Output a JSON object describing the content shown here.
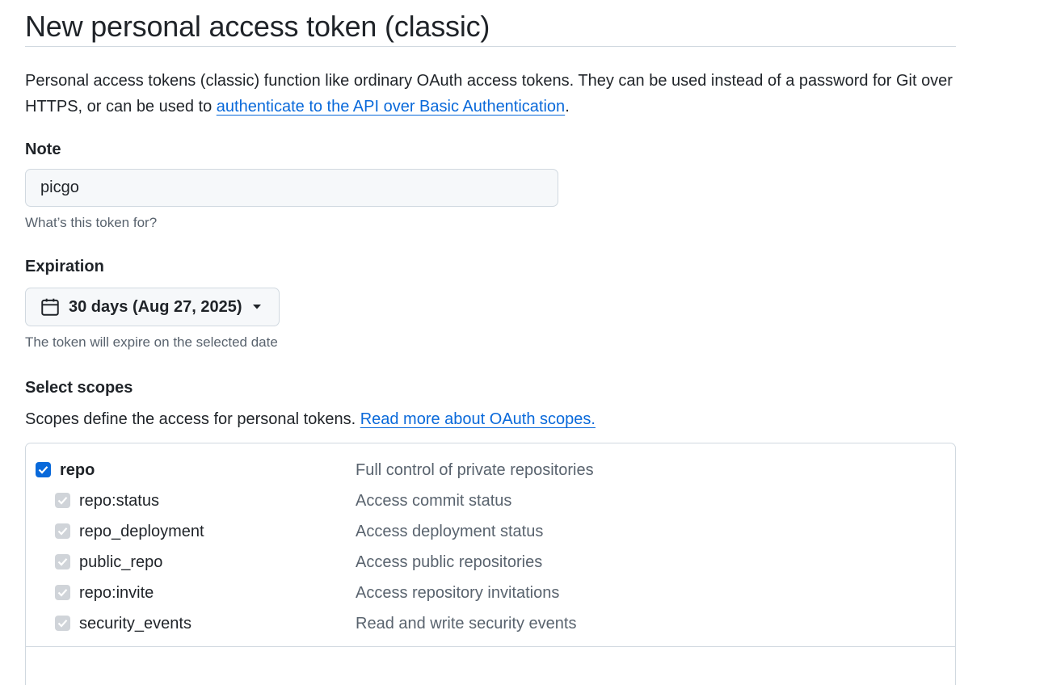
{
  "page": {
    "title": "New personal access token (classic)"
  },
  "intro": {
    "text_before": "Personal access tokens (classic) function like ordinary OAuth access tokens. They can be used instead of a password for Git over HTTPS, or can be used to ",
    "link_text": "authenticate to the API over Basic Authentication",
    "text_after": "."
  },
  "note": {
    "label": "Note",
    "value": "picgo",
    "hint": "What’s this token for?"
  },
  "expiration": {
    "label": "Expiration",
    "selected": "30 days (Aug 27, 2025)",
    "icon": "calendar-icon",
    "hint": "The token will expire on the selected date"
  },
  "scopes": {
    "label": "Select scopes",
    "description": "Scopes define the access for personal tokens. ",
    "link_text": "Read more about OAuth scopes.",
    "items": [
      {
        "name": "repo",
        "description": "Full control of private repositories",
        "checked": true,
        "disabled": false,
        "parent": true
      },
      {
        "name": "repo:status",
        "description": "Access commit status",
        "checked": true,
        "disabled": true,
        "parent": false
      },
      {
        "name": "repo_deployment",
        "description": "Access deployment status",
        "checked": true,
        "disabled": true,
        "parent": false
      },
      {
        "name": "public_repo",
        "description": "Access public repositories",
        "checked": true,
        "disabled": true,
        "parent": false
      },
      {
        "name": "repo:invite",
        "description": "Access repository invitations",
        "checked": true,
        "disabled": true,
        "parent": false
      },
      {
        "name": "security_events",
        "description": "Read and write security events",
        "checked": true,
        "disabled": true,
        "parent": false
      }
    ]
  },
  "colors": {
    "accent": "#0969da",
    "text": "#1f2328",
    "muted": "#59636e",
    "border": "#d1d9e0",
    "disabled_checkbox": "#d0d4d9"
  }
}
